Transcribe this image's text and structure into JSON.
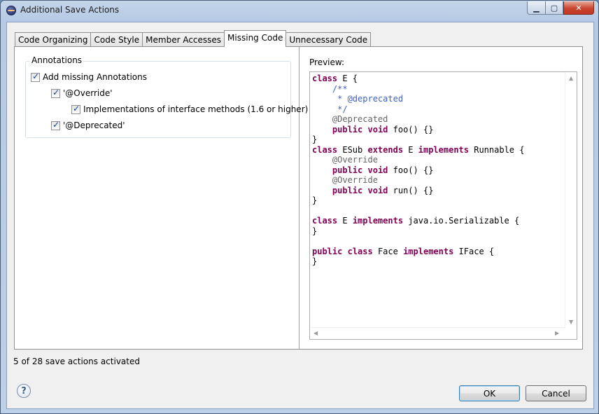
{
  "window": {
    "title": "Additional Save Actions"
  },
  "tabs": [
    {
      "label": "Code Organizing",
      "active": false
    },
    {
      "label": "Code Style",
      "active": false
    },
    {
      "label": "Member Accesses",
      "active": false
    },
    {
      "label": "Missing Code",
      "active": true
    },
    {
      "label": "Unnecessary Code",
      "active": false
    }
  ],
  "annotations_group": {
    "legend": "Annotations",
    "options": [
      {
        "label": "Add missing Annotations",
        "checked": true
      },
      {
        "label": "'@Override'",
        "checked": true
      },
      {
        "label": "Implementations of interface methods (1.6 or higher)",
        "checked": true
      },
      {
        "label": "'@Deprecated'",
        "checked": true
      }
    ]
  },
  "preview": {
    "label": "Preview:"
  },
  "status": {
    "text": "5 of 28 save actions activated"
  },
  "buttons": {
    "ok": "OK",
    "cancel": "Cancel"
  },
  "icons": {
    "help": "help-icon",
    "app": "eclipse-icon",
    "minimize": "minimize-icon",
    "maximize": "maximize-icon",
    "close": "close-icon"
  }
}
